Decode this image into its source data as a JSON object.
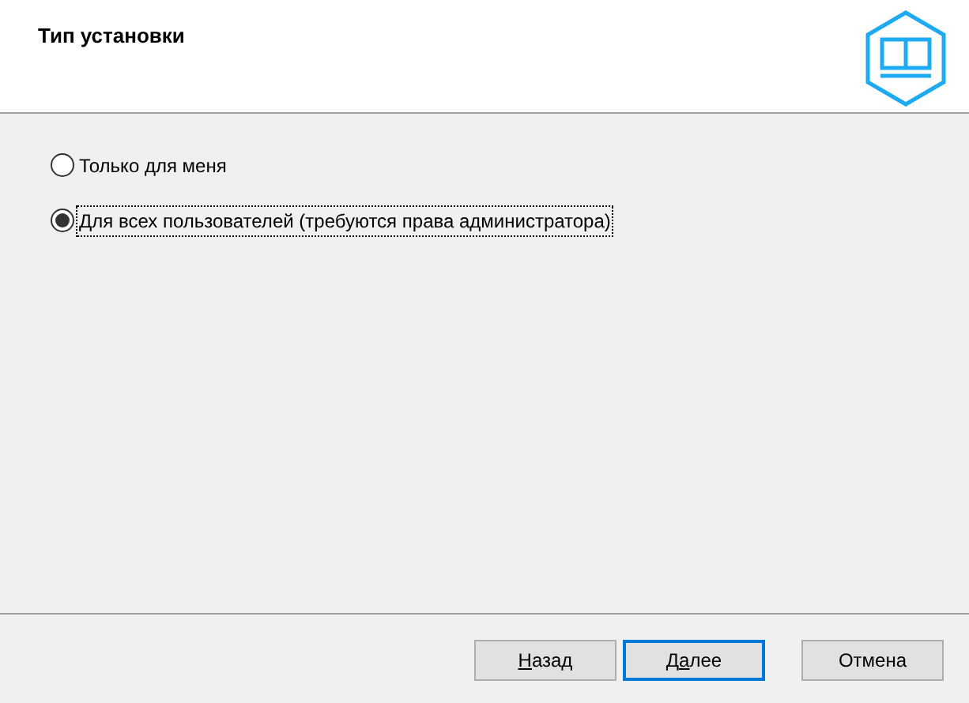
{
  "header": {
    "title": "Тип установки"
  },
  "options": [
    {
      "label": "Только для меня",
      "selected": false
    },
    {
      "label": "Для всех пользователей (требуются права администратора)",
      "selected": true
    }
  ],
  "buttons": [
    {
      "mnemonic": "Н",
      "after": "азад",
      "focused": false
    },
    {
      "before": "Д",
      "mnemonic": "а",
      "after": "лее",
      "focused": true
    },
    {
      "before": "Отмена",
      "focused": false
    }
  ]
}
